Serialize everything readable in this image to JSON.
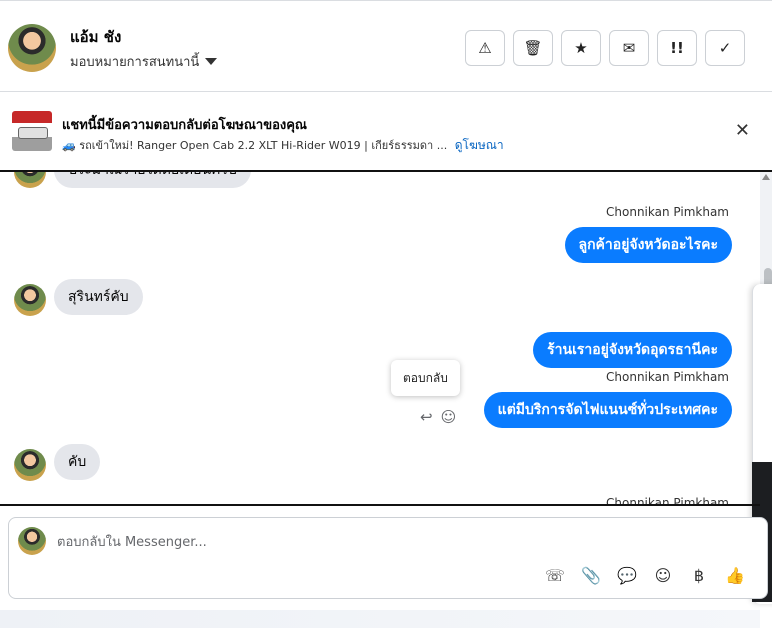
{
  "header": {
    "contact_name": "แอ้ม ชัง",
    "assign_label": "มอบหมายการสนทนานี้",
    "actions": [
      {
        "name": "report-spam-button",
        "icon": "⚠"
      },
      {
        "name": "delete-button",
        "icon": "🗑"
      },
      {
        "name": "star-button",
        "icon": "★"
      },
      {
        "name": "mark-unread-button",
        "icon": "✉"
      },
      {
        "name": "mark-important-button",
        "icon": "!!"
      },
      {
        "name": "mark-done-button",
        "icon": "✓"
      }
    ]
  },
  "ad_banner": {
    "title": "แชทนี้มีข้อความตอบกลับต่อโฆษณาของคุณ",
    "ad_text": "🚙 รถเข้าใหม่! Ranger Open Cab 2.2 XLT Hi-Rider W019 | เกียร์ธรรมดา ...",
    "view_ad_link": "ดูโฆษณา",
    "close_icon": "✕"
  },
  "messages": {
    "partial_top": "ประมาณรายได้ต่อเดือนครับ",
    "sender_1": "Chonnikan Pimkham",
    "out_1": "ลูกค้าอยู่จังหวัดอะไรคะ",
    "in_1": "สุรินทร์คับ",
    "out_2": "ร้านเราอยู่จังหวัดอุดรธานีคะ",
    "sender_2": "Chonnikan Pimkham",
    "out_3": "แต่มีบริการจัดไฟแนนซ์ทั่วประเทศคะ",
    "in_2": "คับ",
    "sender_3_partial": "Chonnikan Pimkham",
    "tooltip": "ตอบกลับ",
    "reply_icon": "↩",
    "react_icon": "☺"
  },
  "composer": {
    "placeholder": "ตอบกลับใน Messenger...",
    "value": "",
    "tools": [
      {
        "name": "call-add-icon",
        "icon": "☏"
      },
      {
        "name": "attach-icon",
        "icon": "📎"
      },
      {
        "name": "saved-replies-icon",
        "icon": "💬"
      },
      {
        "name": "emoji-icon",
        "icon": "☺"
      },
      {
        "name": "payment-icon",
        "icon": "฿"
      },
      {
        "name": "like-icon",
        "icon": "👍"
      }
    ]
  }
}
